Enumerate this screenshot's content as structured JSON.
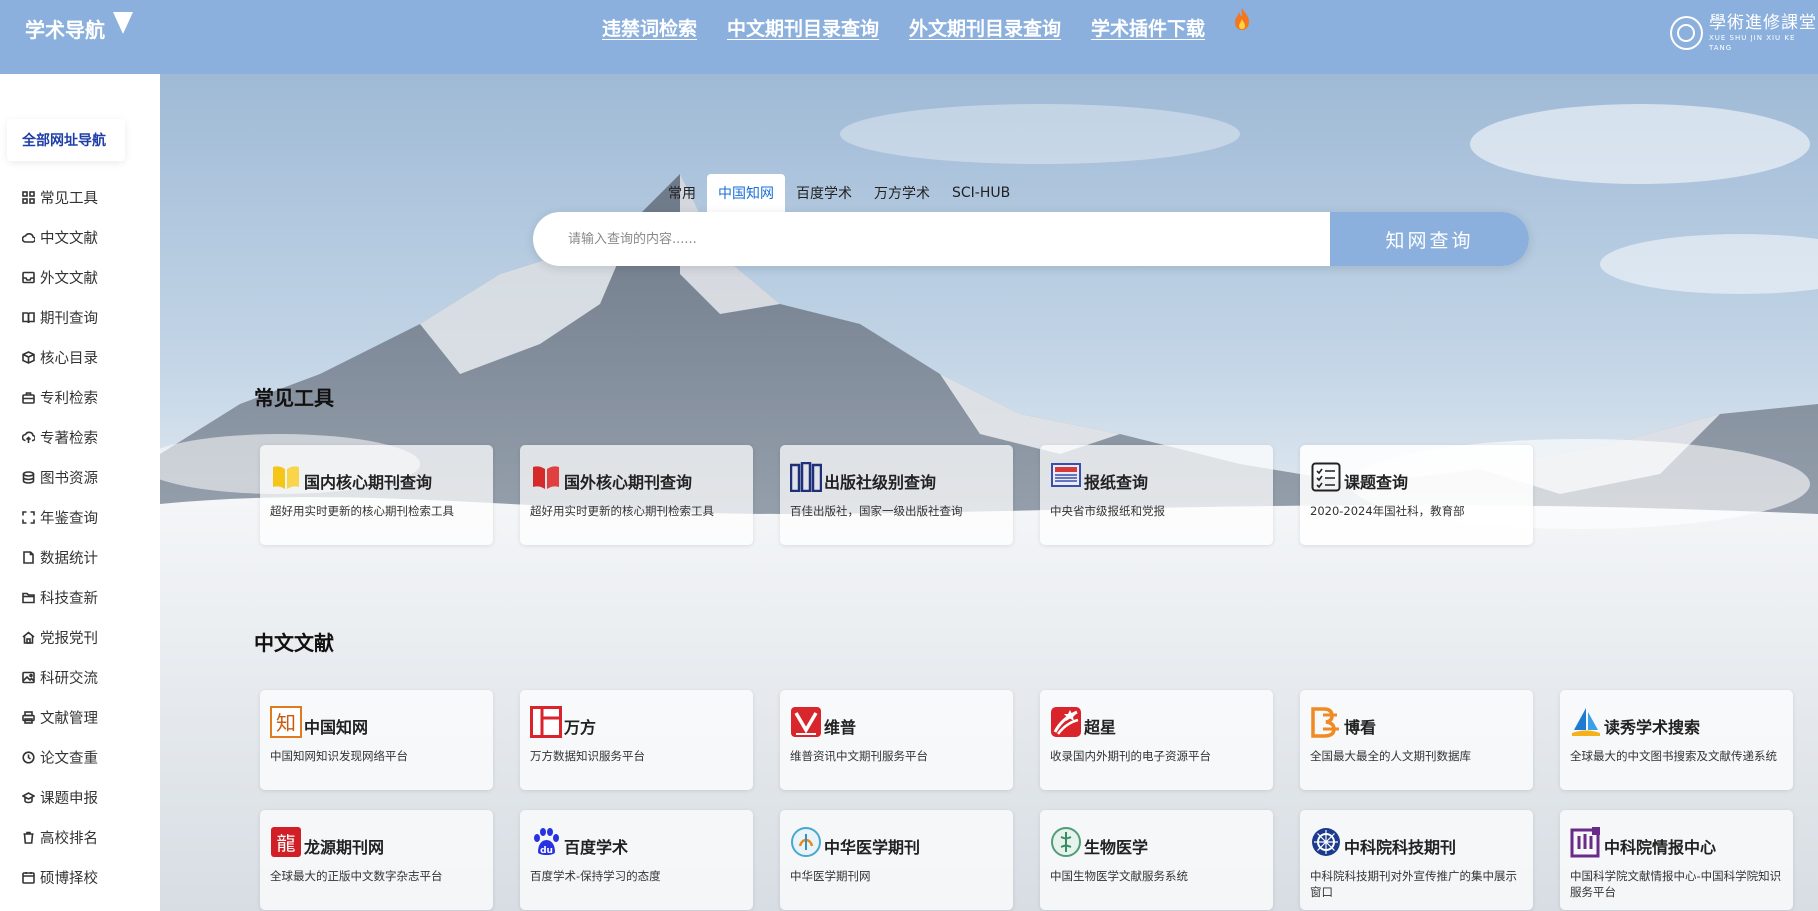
{
  "header": {
    "logo_text": "学术导航",
    "nav": [
      "违禁词检索",
      "中文期刊目录查询",
      "外文期刊目录查询",
      "学术插件下载"
    ],
    "brand_cn": "學術進修課堂",
    "brand_en": "XUE SHU JIN XIU KE TANG",
    "bg_color": "#8bb0dd"
  },
  "sidebar": {
    "title": "全部网址导航",
    "items": [
      {
        "label": "常见工具",
        "icon": "grid-icon"
      },
      {
        "label": "中文文献",
        "icon": "cloud-icon"
      },
      {
        "label": "外文文献",
        "icon": "inbox-icon"
      },
      {
        "label": "期刊查询",
        "icon": "book-icon"
      },
      {
        "label": "核心目录",
        "icon": "box-icon"
      },
      {
        "label": "专利检索",
        "icon": "briefcase-icon"
      },
      {
        "label": "专著检索",
        "icon": "cloud-upload-icon"
      },
      {
        "label": "图书资源",
        "icon": "database-icon"
      },
      {
        "label": "年鉴查询",
        "icon": "expand-icon"
      },
      {
        "label": "数据统计",
        "icon": "file-icon"
      },
      {
        "label": "科技查新",
        "icon": "folder-icon"
      },
      {
        "label": "党报党刊",
        "icon": "home-icon"
      },
      {
        "label": "科研交流",
        "icon": "image-icon"
      },
      {
        "label": "文献管理",
        "icon": "printer-icon"
      },
      {
        "label": "论文查重",
        "icon": "clock-icon"
      },
      {
        "label": "课题申报",
        "icon": "hat-icon"
      },
      {
        "label": "高校排名",
        "icon": "trash-icon"
      },
      {
        "label": "硕博择校",
        "icon": "calendar-icon"
      }
    ]
  },
  "search": {
    "tabs": [
      "常用",
      "中国知网",
      "百度学术",
      "万方学术",
      "SCI-HUB"
    ],
    "active_tab": 1,
    "placeholder": "请输入查询的内容......",
    "button": "知网查询"
  },
  "sections": [
    {
      "title": "常见工具",
      "cards": [
        {
          "title": "国内核心期刊查询",
          "desc": "超好用实时更新的核心期刊检索工具",
          "icon": "yellow-book-icon"
        },
        {
          "title": "国外核心期刊查询",
          "desc": "超好用实时更新的核心期刊检索工具",
          "icon": "red-book-icon"
        },
        {
          "title": "出版社级别查询",
          "desc": "百佳出版社，国家一级出版社查询",
          "icon": "bookshelf-icon"
        },
        {
          "title": "报纸查询",
          "desc": "中央省市级报纸和党报",
          "icon": "newspaper-icon"
        },
        {
          "title": "课题查询",
          "desc": "2020-2024年国社科，教育部",
          "icon": "checklist-icon"
        }
      ]
    },
    {
      "title": "中文文献",
      "cards": [
        {
          "title": "中国知网",
          "desc": "中国知网知识发现网络平台",
          "icon": "cnki-logo-icon"
        },
        {
          "title": "万方",
          "desc": "万方数据知识服务平台",
          "icon": "wanfang-logo-icon"
        },
        {
          "title": "维普",
          "desc": "维普资讯中文期刊服务平台",
          "icon": "vip-logo-icon"
        },
        {
          "title": "超星",
          "desc": "收录国内外期刊的电子资源平台",
          "icon": "chaoxing-logo-icon"
        },
        {
          "title": "博看",
          "desc": "全国最大最全的人文期刊数据库",
          "icon": "bookan-logo-icon"
        },
        {
          "title": "读秀学术搜索",
          "desc": "全球最大的中文图书搜索及文献传递系统",
          "icon": "duxiu-logo-icon"
        },
        {
          "title": "龙源期刊网",
          "desc": "全球最大的正版中文数字杂志平台",
          "icon": "longyuan-logo-icon"
        },
        {
          "title": "百度学术",
          "desc": "百度学术-保持学习的态度",
          "icon": "baidu-paw-icon"
        },
        {
          "title": "中华医学期刊",
          "desc": "中华医学期刊网",
          "icon": "cma-logo-icon"
        },
        {
          "title": "生物医学",
          "desc": "中国生物医学文献服务系统",
          "icon": "biomed-logo-icon"
        },
        {
          "title": "中科院科技期刊",
          "desc": "中科院科技期刊对外宣传推广的集中展示窗口",
          "icon": "cas-logo-icon"
        },
        {
          "title": "中科院情报中心",
          "desc": "中国科学院文献情报中心-中国科学院知识服务平台",
          "icon": "las-logo-icon"
        }
      ]
    }
  ]
}
